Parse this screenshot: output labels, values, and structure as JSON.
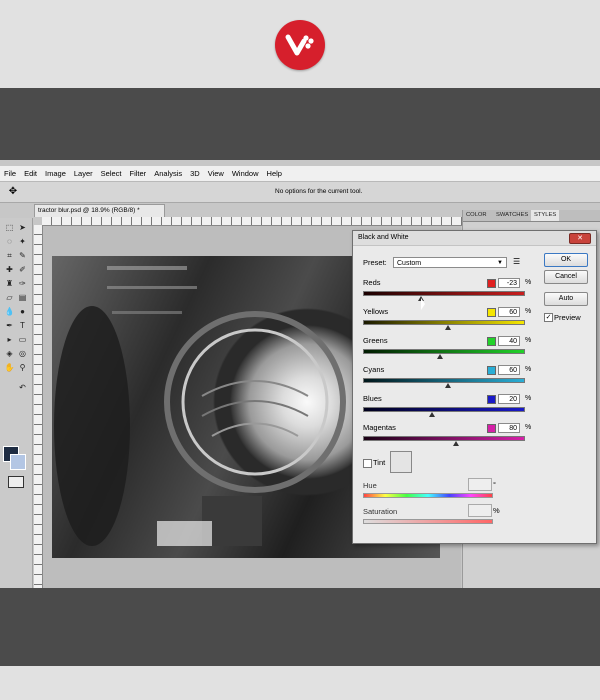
{
  "menu": [
    "File",
    "Edit",
    "Image",
    "Layer",
    "Select",
    "Filter",
    "Analysis",
    "3D",
    "View",
    "Window",
    "Help"
  ],
  "options_bar": {
    "message": "No options for the current tool."
  },
  "document": {
    "tab_title": "tractor blur.psd @ 18.9% (RGB/8) *"
  },
  "panel_tabs": [
    "COLOR",
    "SWATCHES",
    "STYLES"
  ],
  "dialog": {
    "title": "Black and White",
    "preset_label": "Preset:",
    "preset_value": "Custom",
    "percent": "%",
    "sliders": [
      {
        "label": "Reds",
        "value": "-23",
        "fraction": 0.36,
        "color": "#e02020"
      },
      {
        "label": "Yellows",
        "value": "60",
        "fraction": 0.53,
        "color": "#f5e600"
      },
      {
        "label": "Greens",
        "value": "40",
        "fraction": 0.48,
        "color": "#22d22a"
      },
      {
        "label": "Cyans",
        "value": "60",
        "fraction": 0.53,
        "color": "#2aaed6"
      },
      {
        "label": "Blues",
        "value": "20",
        "fraction": 0.43,
        "color": "#1a1ac8"
      },
      {
        "label": "Magentas",
        "value": "80",
        "fraction": 0.58,
        "color": "#d620a8"
      }
    ],
    "tint_label": "Tint",
    "hue_label": "Hue",
    "hue_unit": "°",
    "saturation_label": "Saturation",
    "saturation_unit": "%",
    "buttons": {
      "ok": "OK",
      "cancel": "Cancel",
      "auto": "Auto"
    },
    "preview_label": "Preview",
    "preview_checked": true
  },
  "colors": {
    "brand": "#d61f2c",
    "foreground": "#1e2c42",
    "background": "#b3c6e4"
  }
}
